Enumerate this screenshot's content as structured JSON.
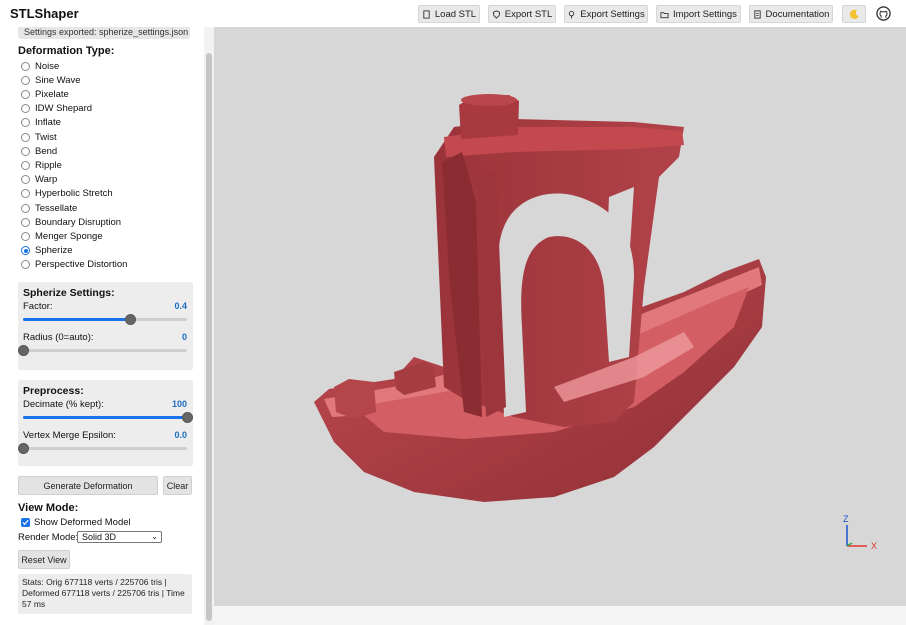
{
  "header": {
    "title": "STLShaper",
    "buttons": {
      "load": "Load STL",
      "export_stl": "Export STL",
      "export_settings": "Export Settings",
      "import_settings": "Import Settings",
      "documentation": "Documentation"
    }
  },
  "sidebar": {
    "export_note": "Settings exported: spherize_settings.json",
    "deformation_title": "Deformation Type:",
    "deformation_types": [
      "Noise",
      "Sine Wave",
      "Pixelate",
      "IDW Shepard",
      "Inflate",
      "Twist",
      "Bend",
      "Ripple",
      "Warp",
      "Hyperbolic Stretch",
      "Tessellate",
      "Boundary Disruption",
      "Menger Sponge",
      "Spherize",
      "Perspective Distortion"
    ],
    "selected_type": "Spherize",
    "spherize": {
      "title": "Spherize Settings:",
      "factor_label": "Factor:",
      "factor_value": "0.4",
      "factor_fraction": 0.65,
      "radius_label": "Radius (0=auto):",
      "radius_value": "0",
      "radius_fraction": 0.0
    },
    "preprocess": {
      "title": "Preprocess:",
      "decimate_label": "Decimate (% kept):",
      "decimate_value": "100",
      "decimate_fraction": 1.0,
      "epsilon_label": "Vertex Merge Epsilon:",
      "epsilon_value": "0.0",
      "epsilon_fraction": 0.0
    },
    "generate_button": "Generate Deformation",
    "clear_button": "Clear",
    "view_mode_title": "View Mode:",
    "show_deformed_label": "Show Deformed Model",
    "render_mode_label": "Render Mode:",
    "render_mode_value": "Solid 3D",
    "reset_view_button": "Reset View",
    "stats": "Stats: Orig 677118 verts / 225706 tris | Deformed 677118 verts / 225706 tris | Time 57 ms"
  },
  "axes": {
    "z": "Z",
    "x": "X",
    "z_color": "#1a4fd0",
    "x_color": "#e0352b",
    "y_color": "#2aa84a"
  },
  "colors": {
    "accent": "#1a73e8",
    "model": "#a83a40"
  }
}
